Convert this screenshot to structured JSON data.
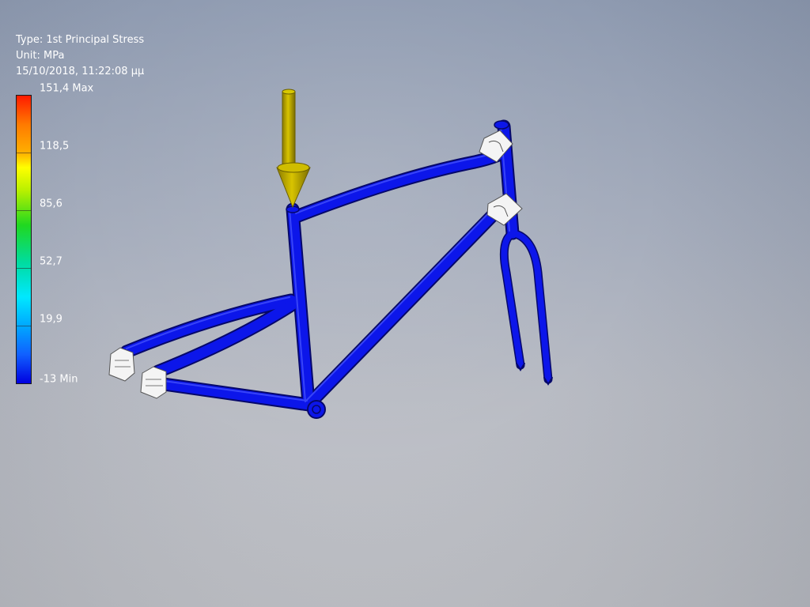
{
  "result": {
    "type_line": "Type: 1st Principal Stress",
    "unit_line": "Unit: MPa",
    "timestamp_line": "15/10/2018, 11:22:08 μμ"
  },
  "legend": {
    "max_label": "151,4 Max",
    "ticks": [
      "118,5",
      "85,6",
      "52,7",
      "19,9"
    ],
    "min_label": "-13 Min"
  },
  "model": {
    "load_arrow_color": "#c8b400",
    "frame_color": "#0b14e6",
    "constraint_color": "#f2f2f2"
  }
}
